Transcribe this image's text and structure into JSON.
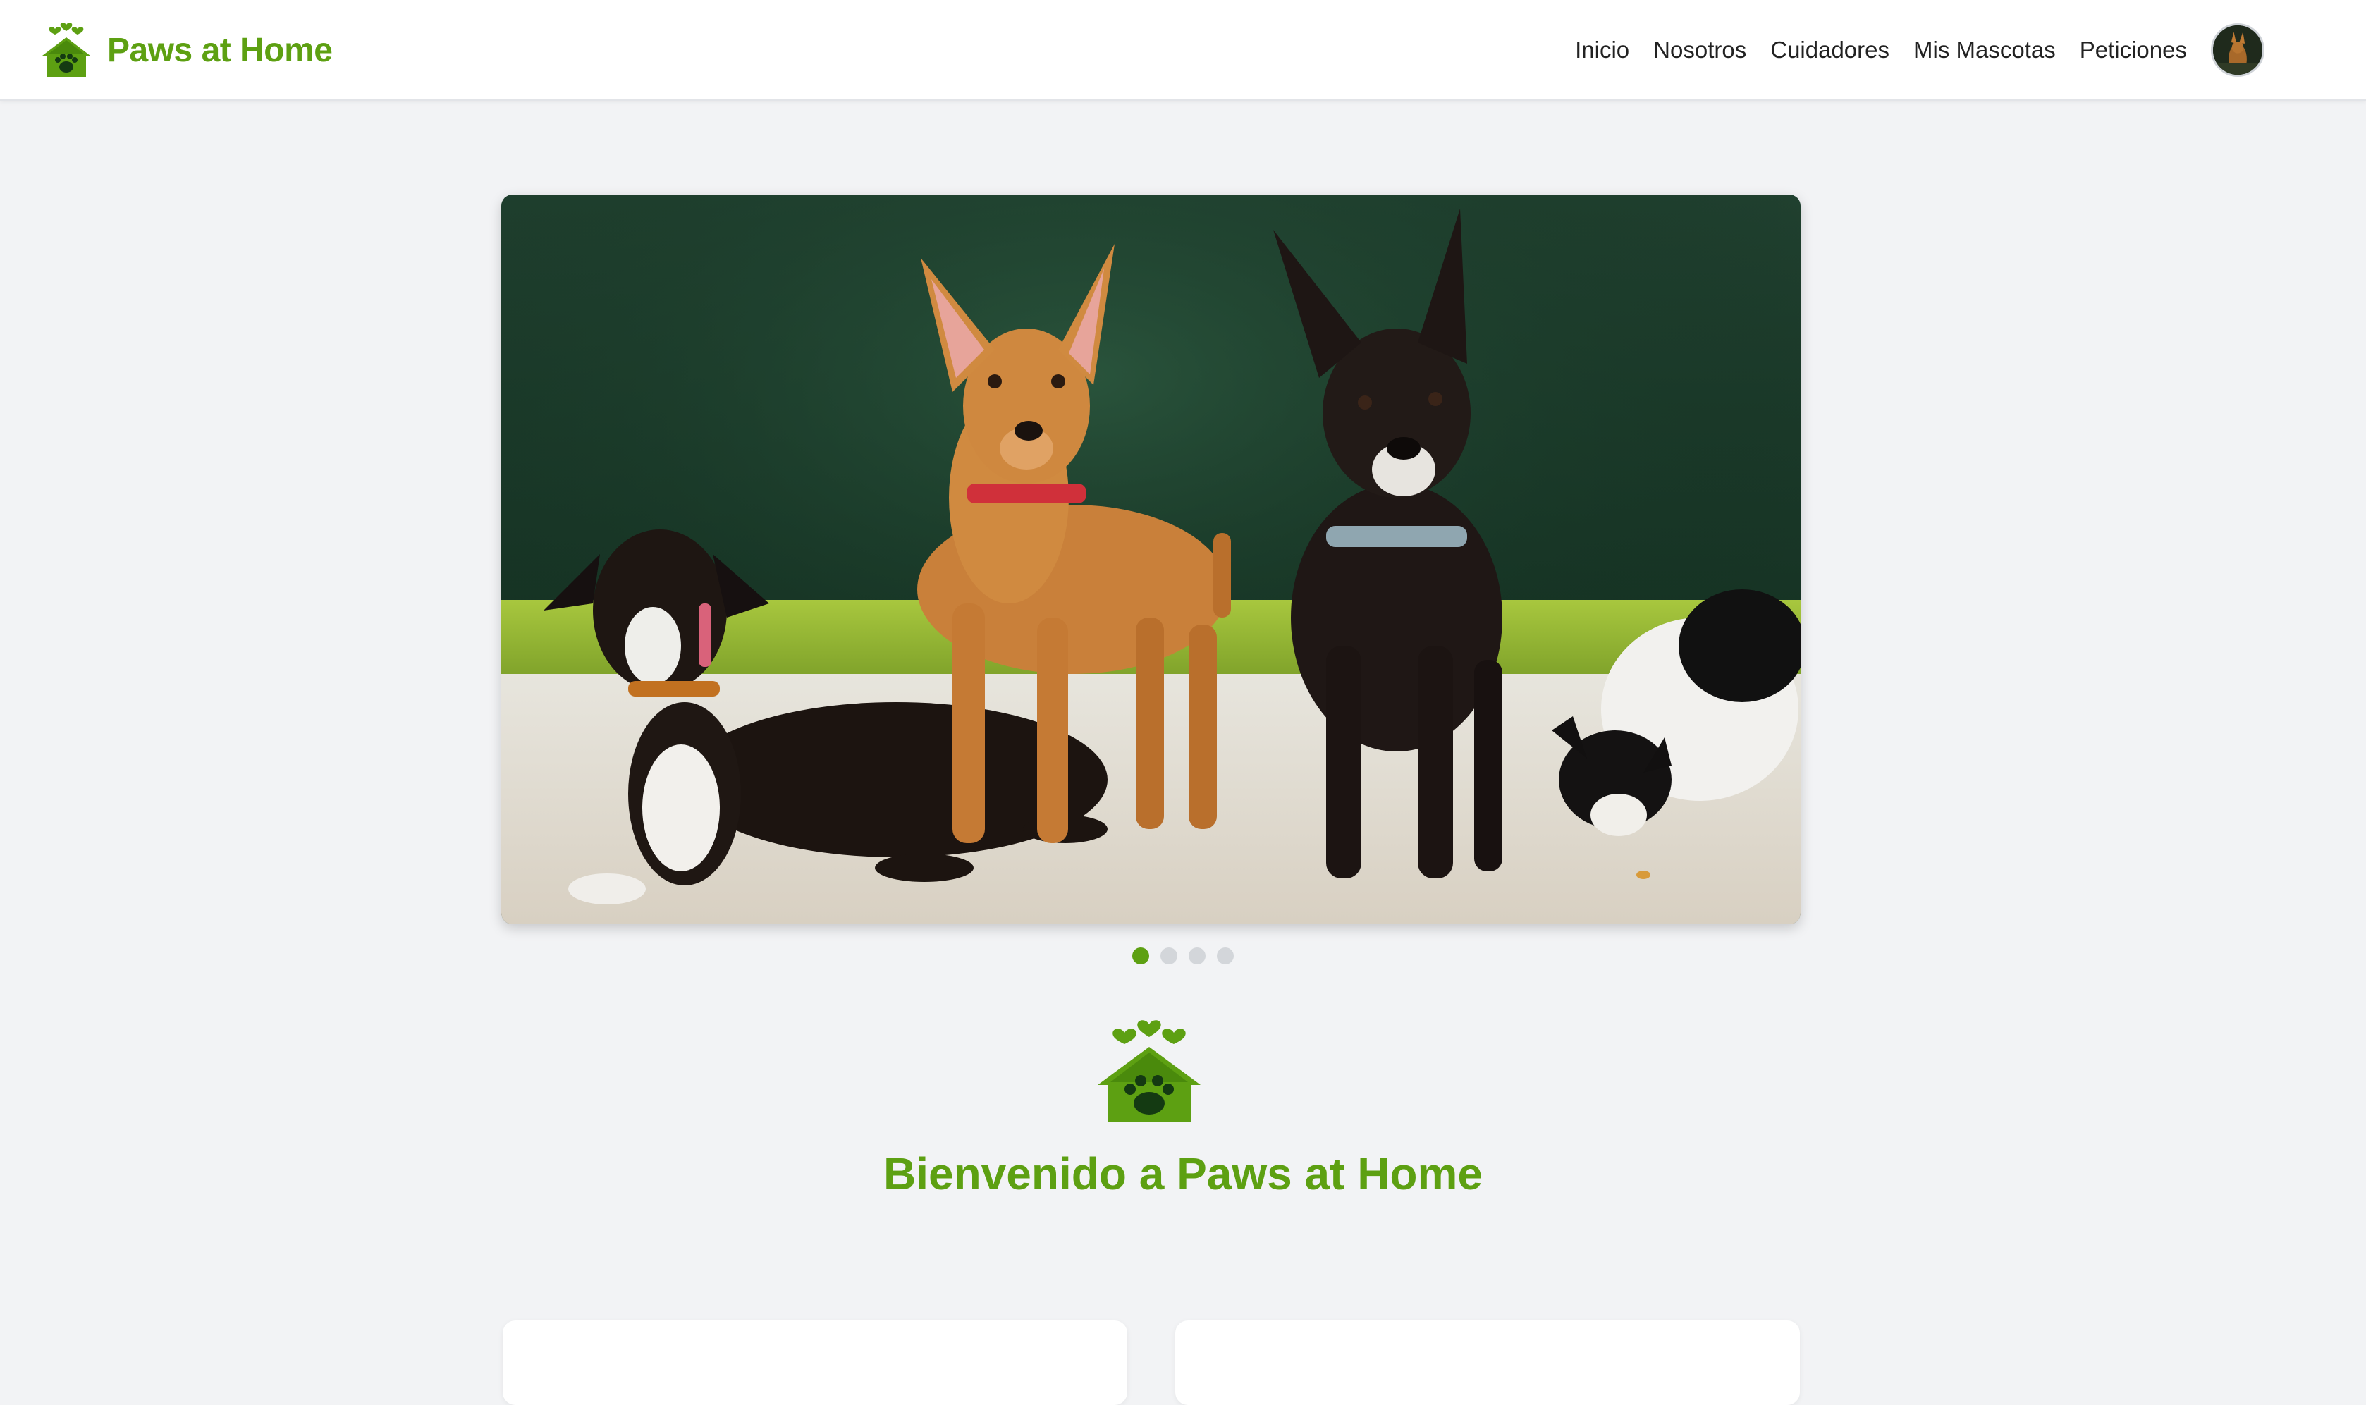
{
  "brand": {
    "name": "Paws at Home",
    "logo_icon": "paw-house-icon",
    "color": "#5da012"
  },
  "nav": {
    "items": [
      {
        "label": "Inicio"
      },
      {
        "label": "Nosotros"
      },
      {
        "label": "Cuidadores"
      },
      {
        "label": "Mis Mascotas"
      },
      {
        "label": "Peticiones"
      }
    ],
    "avatar_icon": "user-avatar"
  },
  "carousel": {
    "slide_count": 4,
    "active_index": 0,
    "image": "three-dogs-and-cat-photo"
  },
  "welcome": {
    "title": "Bienvenido a Paws at Home",
    "icon": "paw-house-icon"
  },
  "colors": {
    "accent": "#5da012",
    "page_bg": "#f2f3f5",
    "inactive_dot": "#d3d6da"
  }
}
